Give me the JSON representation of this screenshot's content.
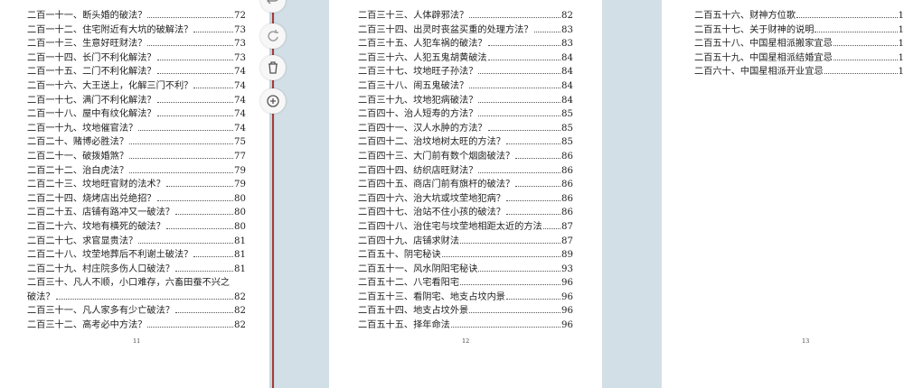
{
  "pages": [
    {
      "number": "11",
      "entries": [
        {
          "title": "二百一十一、断头婚的破法？",
          "page": "72"
        },
        {
          "title": "二百一十二、住宅附近有大坑的破解法？",
          "page": "73"
        },
        {
          "title": "二百一十三、生意好旺财法？",
          "page": "73"
        },
        {
          "title": "二百一十四、长门不利化解法？",
          "page": "73"
        },
        {
          "title": "二百一十五、二门不利化解法？",
          "page": "74"
        },
        {
          "title": "二百一十六、大王送上，化解三门不利？",
          "page": "74"
        },
        {
          "title": "二百一十七、满门不利化解法？",
          "page": "74"
        },
        {
          "title": "二百一十八、屋中有纹化解法？",
          "page": "74"
        },
        {
          "title": "二百一十九、坟地催官法？",
          "page": "74"
        },
        {
          "title": "二百二十、赌博必胜法？",
          "page": "75"
        },
        {
          "title": "二百二十一、破拨婚煞？",
          "page": "77"
        },
        {
          "title": "二百二十二、治白虎法？",
          "page": "79"
        },
        {
          "title": "二百二十三、坟地旺官财的法术？",
          "page": "79"
        },
        {
          "title": "二百二十四、烧烤店出兑绝招？",
          "page": "80"
        },
        {
          "title": "二百二十五、店铺有路冲又一破法？",
          "page": "80"
        },
        {
          "title": "二百二十六、坟地有横死的破法？",
          "page": "80"
        },
        {
          "title": "二百二十七、求官显贵法？",
          "page": "81"
        },
        {
          "title": "二百二十八、坟茔地葬后不利谢土破法？",
          "page": "81"
        },
        {
          "title": "二百二十九、村庄院多伤人口破法？",
          "page": "81"
        },
        {
          "title": "二百三十、凡人不顺，小口难存，六畜田蚕不兴之",
          "cont": "破法？",
          "page": "82"
        },
        {
          "title": "二百三十一、凡人家多有少亡破法？",
          "page": "82"
        },
        {
          "title": "二百三十二、高考必中方法？",
          "page": "82"
        }
      ]
    },
    {
      "number": "12",
      "entries": [
        {
          "title": "二百三十三、人体辟邪法？",
          "page": "82"
        },
        {
          "title": "二百三十四、出灵时丧盆买重的处理方法？",
          "page": "83"
        },
        {
          "title": "二百三十五、人犯车祸的破法？",
          "page": "83"
        },
        {
          "title": "二百三十六、人犯五鬼胡黄破法",
          "page": "84"
        },
        {
          "title": "二百三十七、坟地旺子孙法？",
          "page": "84"
        },
        {
          "title": "二百三十八、闹五鬼破法？",
          "page": "84"
        },
        {
          "title": "二百三十九、坟地犯病破法？",
          "page": "84"
        },
        {
          "title": "二百四十、治人短寿的方法？",
          "page": "85"
        },
        {
          "title": "二百四十一、汉人水肿的方法？",
          "page": "85"
        },
        {
          "title": "二百四十二、治坟地树太旺的方法？",
          "page": "85"
        },
        {
          "title": "二百四十三、大门前有数个烟囱破法？",
          "page": "86"
        },
        {
          "title": "二百四十四、纺织店旺财法？",
          "page": "86"
        },
        {
          "title": "二百四十五、商店门前有旗杆的破法？",
          "page": "86"
        },
        {
          "title": "二百四十六、治大坑或坟茔地犯病？",
          "page": "86"
        },
        {
          "title": "二百四十七、治站不住小孩的破法？",
          "page": "86"
        },
        {
          "title": "二百四十八、治住宅与坟茔地相距太近的方法",
          "page": "87"
        },
        {
          "title": "二百四十九、店铺求财法",
          "page": "87"
        },
        {
          "title": "二百五十、阴宅秘诀",
          "page": "89"
        },
        {
          "title": "二百五十一、风水阴阳宅秘诀",
          "page": "93"
        },
        {
          "title": "二百五十二、八宅看阳宅",
          "page": "96"
        },
        {
          "title": "二百五十三、看阴宅、地支占坟内景",
          "page": "96"
        },
        {
          "title": "二百五十四、地支占坟外景",
          "page": "96"
        },
        {
          "title": "二百五十五、择年命法",
          "page": "96"
        }
      ]
    },
    {
      "number": "13",
      "entries": [
        {
          "title": "二百五十六、财神方位歌",
          "page": "1"
        },
        {
          "title": "二百五十七、关于财神的说明",
          "page": "1"
        },
        {
          "title": "二百五十八、中国星相派搬家宜忌",
          "page": "1"
        },
        {
          "title": "二百五十九、中国星相派结婚宜忌",
          "page": "1"
        },
        {
          "title": "二百六十、中国星相派开业宜忌",
          "page": "1"
        }
      ]
    }
  ],
  "toolbar": [
    "undo-icon",
    "redo-icon",
    "trash-icon",
    "add-icon"
  ]
}
